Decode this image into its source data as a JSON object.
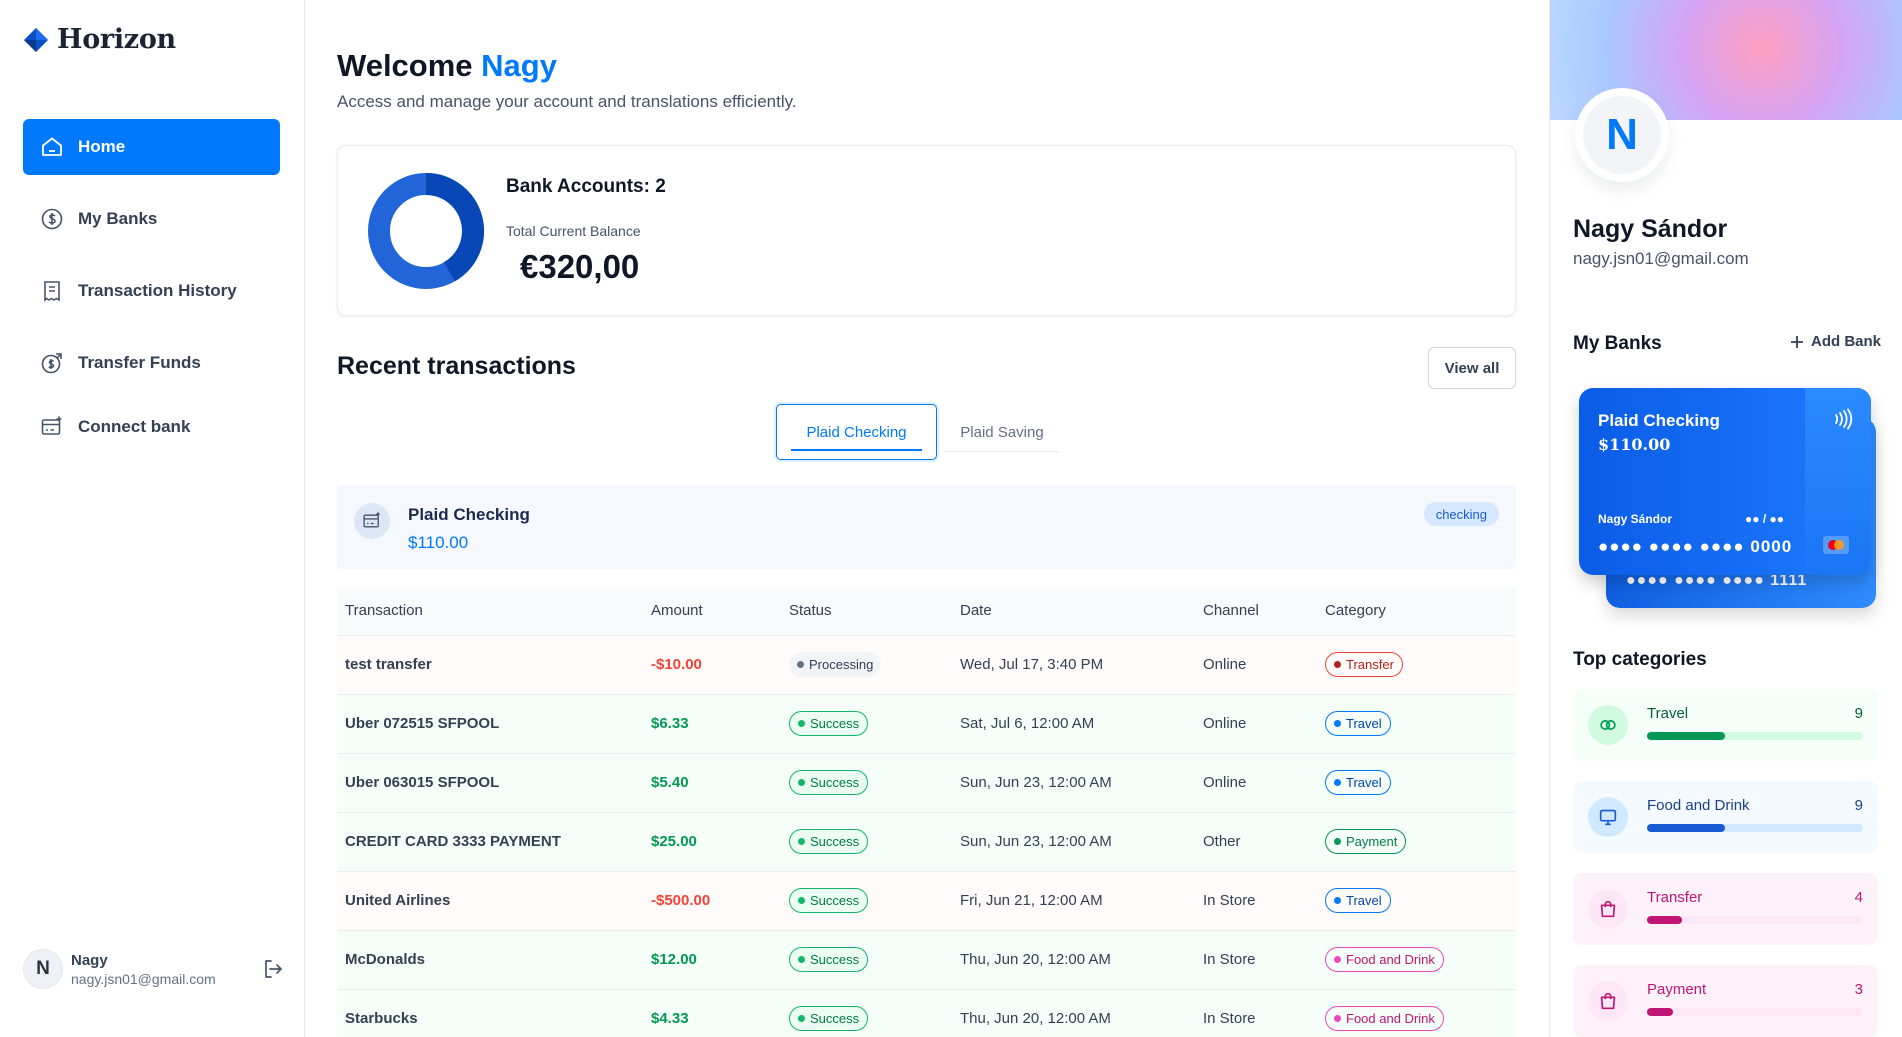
{
  "app": {
    "name": "Horizon"
  },
  "sidebar": {
    "items": [
      {
        "label": "Home",
        "icon": "home-icon",
        "active": true
      },
      {
        "label": "My Banks",
        "icon": "dollar-circle-icon",
        "active": false
      },
      {
        "label": "Transaction History",
        "icon": "receipt-icon",
        "active": false
      },
      {
        "label": "Transfer Funds",
        "icon": "money-send-icon",
        "active": false
      },
      {
        "label": "Connect bank",
        "icon": "connect-bank-icon",
        "active": false
      }
    ],
    "user": {
      "initial": "N",
      "name": "Nagy",
      "email": "nagy.jsn01@gmail.com"
    }
  },
  "header": {
    "welcome": "Welcome",
    "user_name": "Nagy",
    "subtitle": "Access and manage your account and translations efficiently."
  },
  "balance": {
    "accounts_label": "Bank Accounts: 2",
    "total_label": "Total Current Balance",
    "total_value": "€320,00"
  },
  "recent": {
    "title": "Recent transactions",
    "view_all": "View all",
    "tabs": [
      {
        "label": "Plaid Checking",
        "active": true
      },
      {
        "label": "Plaid Saving",
        "active": false
      }
    ],
    "account": {
      "name": "Plaid Checking",
      "balance": "$110.00",
      "badge": "checking"
    },
    "columns": [
      "Transaction",
      "Amount",
      "Status",
      "Date",
      "Channel",
      "Category"
    ],
    "rows": [
      {
        "name": "test transfer",
        "amount": "-$10.00",
        "status": "Processing",
        "date": "Wed, Jul 17, 3:40 PM",
        "channel": "Online",
        "category": "Transfer"
      },
      {
        "name": "Uber 072515 SFPOOL",
        "amount": "$6.33",
        "status": "Success",
        "date": "Sat, Jul 6, 12:00 AM",
        "channel": "Online",
        "category": "Travel"
      },
      {
        "name": "Uber 063015 SFPOOL",
        "amount": "$5.40",
        "status": "Success",
        "date": "Sun, Jun 23, 12:00 AM",
        "channel": "Online",
        "category": "Travel"
      },
      {
        "name": "CREDIT CARD 3333 PAYMENT",
        "amount": "$25.00",
        "status": "Success",
        "date": "Sun, Jun 23, 12:00 AM",
        "channel": "Other",
        "category": "Payment"
      },
      {
        "name": "United Airlines",
        "amount": "-$500.00",
        "status": "Success",
        "date": "Fri, Jun 21, 12:00 AM",
        "channel": "In Store",
        "category": "Travel"
      },
      {
        "name": "McDonalds",
        "amount": "$12.00",
        "status": "Success",
        "date": "Thu, Jun 20, 12:00 AM",
        "channel": "In Store",
        "category": "Food and Drink"
      },
      {
        "name": "Starbucks",
        "amount": "$4.33",
        "status": "Success",
        "date": "Thu, Jun 20, 12:00 AM",
        "channel": "In Store",
        "category": "Food and Drink"
      }
    ]
  },
  "profile": {
    "initial": "N",
    "name": "Nagy Sándor",
    "email": "nagy.jsn01@gmail.com"
  },
  "banks": {
    "title": "My Banks",
    "add_label": "Add Bank",
    "front_card": {
      "name": "Plaid Checking",
      "balance": "$110.00",
      "holder": "Nagy Sándor",
      "expiry": "●● / ●●",
      "number": "●●●● ●●●● ●●●● 0000"
    },
    "back_card": {
      "number": "●●●● ●●●● ●●●● 1111"
    }
  },
  "top_categories": {
    "title": "Top categories",
    "items": [
      {
        "name": "Travel",
        "count": "9",
        "fraction": 0.36,
        "theme": "green",
        "icon": "travel-icon"
      },
      {
        "name": "Food and Drink",
        "count": "9",
        "fraction": 0.36,
        "theme": "blue",
        "icon": "monitor-icon"
      },
      {
        "name": "Transfer",
        "count": "4",
        "fraction": 0.16,
        "theme": "pink",
        "icon": "shopping-bag-icon"
      },
      {
        "name": "Payment",
        "count": "3",
        "fraction": 0.12,
        "theme": "pink",
        "icon": "shopping-bag-icon"
      }
    ]
  },
  "colors": {
    "accent": "#0179fe",
    "negative": "#f04438",
    "positive": "#039855",
    "donut": [
      "#0747b6",
      "#2265d8"
    ]
  }
}
